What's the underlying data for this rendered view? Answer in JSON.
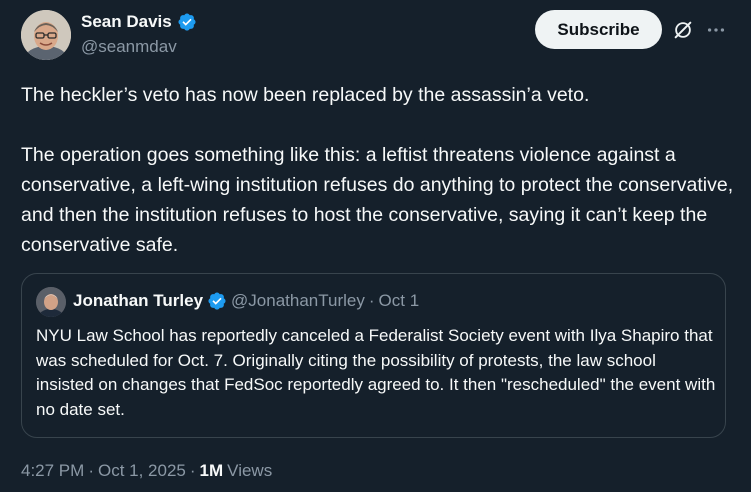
{
  "author": {
    "name": "Sean Davis",
    "handle": "@seanmdav",
    "verified_color": "#1d9bf0"
  },
  "actions": {
    "subscribe_label": "Subscribe",
    "grok_icon": "grok-icon",
    "more_icon": "more-icon"
  },
  "tweet": {
    "paragraph_1": "The heckler’s veto has now been replaced by the assassin’a veto.",
    "paragraph_2": "The operation goes something like this: a leftist threatens violence against a conservative, a left-wing institution refuses do anything to protect the conservative, and then the institution refuses to host the conservative, saying it can’t keep the conservative safe."
  },
  "quote": {
    "name": "Jonathan Turley",
    "handle": "@JonathanTurley",
    "separator": "·",
    "date": "Oct 1",
    "text": "NYU Law School has reportedly canceled a Federalist Society event with Ilya Shapiro that was scheduled for Oct. 7. Originally citing the possibility of protests, the law school insisted on changes that FedSoc reportedly agreed to. It then \"rescheduled\" the event with no date set."
  },
  "meta": {
    "time": "4:27 PM",
    "separator": "·",
    "date": "Oct 1, 2025",
    "separator2": "·",
    "views_count": "1M",
    "views_label": "Views"
  },
  "colors": {
    "background": "#15202b",
    "primary_text": "#f7f9f9",
    "secondary_text": "#8b98a5",
    "border": "#38444d",
    "button_bg": "#eff3f4"
  }
}
